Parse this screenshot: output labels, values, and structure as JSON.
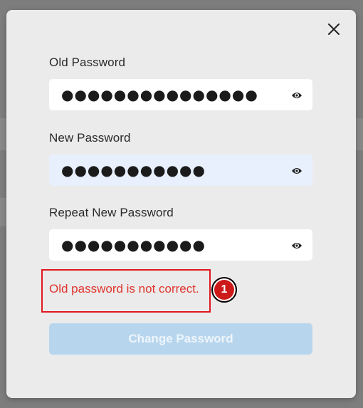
{
  "form": {
    "old_password": {
      "label": "Old Password",
      "masked_value": "●●●●●●●●●●●●●●●"
    },
    "new_password": {
      "label": "New Password",
      "masked_value": "●●●●●●●●●●●"
    },
    "repeat_password": {
      "label": "Repeat New Password",
      "masked_value": "●●●●●●●●●●●"
    },
    "error_message": "Old password is not correct.",
    "submit_label": "Change Password",
    "submit_disabled": true
  },
  "annotation": {
    "badge_number": "1",
    "color": "#e0191f"
  },
  "icons": {
    "close": "close-icon",
    "visibility": "eye-icon"
  },
  "colors": {
    "error_text": "#e0332d",
    "button_disabled": "#b7d6ee",
    "autofill": "#e8f0fe"
  }
}
